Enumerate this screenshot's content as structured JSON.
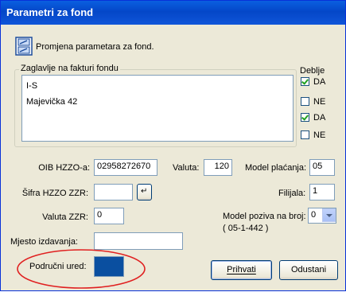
{
  "window": {
    "title": "Parametri za fond"
  },
  "header": {
    "description": "Promjena parametara za fond.",
    "icon": "document-settings-icon"
  },
  "invoice_header": {
    "group_label": "Zaglavlje na fakturi fondu",
    "lines": [
      "I-S",
      "Majevička 42"
    ],
    "bold_label": "Deblje",
    "options": [
      {
        "label": "DA",
        "checked": true
      },
      {
        "label": "NE",
        "checked": false
      },
      {
        "label": "DA",
        "checked": true
      },
      {
        "label": "NE",
        "checked": false
      }
    ]
  },
  "form": {
    "oib_label": "OIB HZZO-a:",
    "oib_value": "02958272670",
    "valuta_label": "Valuta:",
    "valuta_value": "120",
    "model_placanja_label": "Model plaćanja:",
    "model_placanja_value": "05",
    "sifra_label": "Šifra HZZO ZZR:",
    "sifra_value": "",
    "filijala_label": "Filijala:",
    "filijala_value": "1",
    "valuta_zzr_label": "Valuta ZZR:",
    "valuta_zzr_value": "0",
    "model_poziva_label": "Model poziva na broj:",
    "model_poziva_value": "0",
    "model_poziva_hint": "( 05-1-442 )",
    "mjesto_label": "Mjesto izdavanja:",
    "mjesto_value": "",
    "podrucni_label": "Područni ured:",
    "podrucni_color": "#0a4fa0"
  },
  "buttons": {
    "accept": "Prihvati",
    "cancel": "Odustani"
  },
  "colors": {
    "highlight_ellipse": "#e02020",
    "title_bar": "#0a5fe0"
  }
}
